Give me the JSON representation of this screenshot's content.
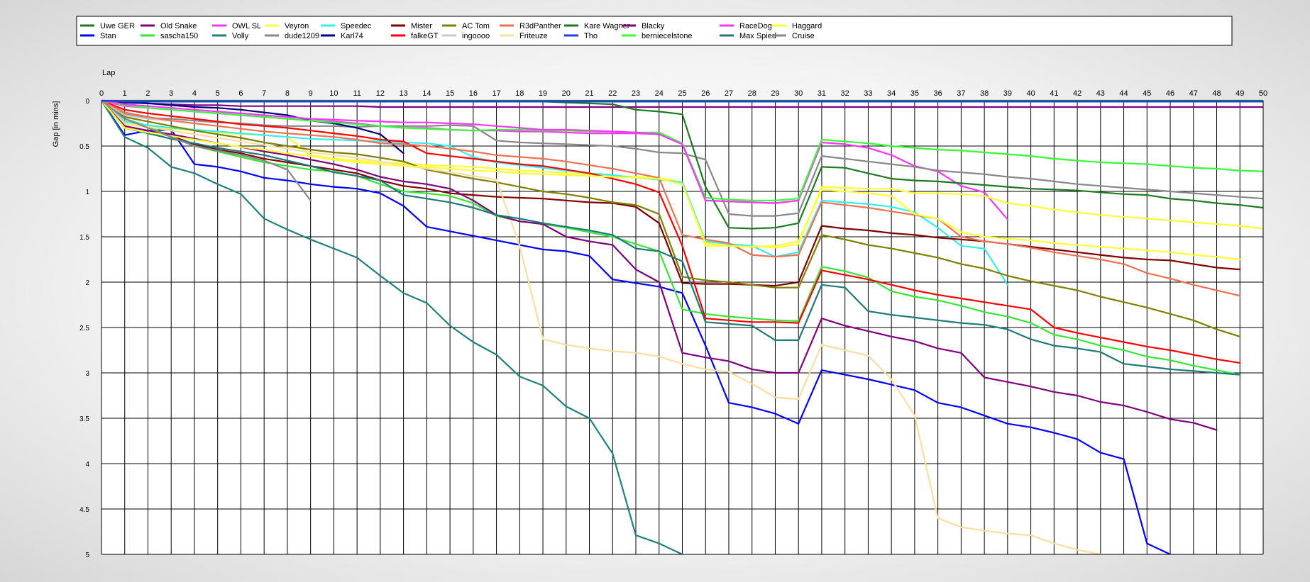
{
  "chart_data": {
    "type": "line",
    "title": "",
    "xlabel": "Lap",
    "ylabel": "Gap [in mins]",
    "x_ticks": [
      0,
      1,
      2,
      3,
      4,
      5,
      6,
      7,
      8,
      9,
      10,
      11,
      12,
      13,
      14,
      15,
      16,
      17,
      18,
      19,
      20,
      21,
      22,
      23,
      24,
      25,
      26,
      27,
      28,
      29,
      30,
      31,
      32,
      33,
      34,
      35,
      36,
      37,
      38,
      39,
      40,
      41,
      42,
      43,
      44,
      45,
      46,
      47,
      48,
      49,
      50
    ],
    "y_ticks": [
      "0",
      "0.5",
      "1",
      "1.5",
      "2",
      "2.5",
      "3",
      "3.5",
      "4",
      "4.5",
      "5"
    ],
    "xlim": [
      0,
      50
    ],
    "ylim": [
      0,
      5
    ],
    "y_inverted": true,
    "grid": true,
    "legend_position": "top",
    "series": [
      {
        "name": "Uwe GER",
        "color": "#1e7a1e",
        "values": [
          0,
          0,
          0,
          0,
          0,
          0,
          0,
          0,
          0,
          0,
          0,
          0,
          0,
          0,
          0,
          0,
          0,
          0,
          0,
          0,
          0,
          0,
          0,
          0,
          0,
          0,
          0,
          0,
          0,
          0,
          0,
          0,
          0,
          0,
          0,
          0,
          0,
          0,
          0,
          0,
          0,
          0,
          0,
          0,
          0,
          0,
          0,
          0,
          0,
          0,
          0
        ]
      },
      {
        "name": "Stan",
        "color": "#0000ff",
        "values": [
          0,
          0.38,
          0.33,
          0.32,
          0.7,
          0.73,
          0.78,
          0.85,
          0.88,
          0.92,
          0.95,
          0.97,
          1.02,
          1.16,
          1.39,
          1.44,
          1.49,
          1.54,
          1.59,
          1.64,
          1.66,
          1.71,
          1.97,
          2.01,
          2.05,
          2.12,
          2.7,
          3.33,
          3.38,
          3.45,
          3.56,
          2.97,
          3.02,
          3.07,
          3.13,
          3.19,
          3.33,
          3.38,
          3.47,
          3.56,
          3.6,
          3.66,
          3.73,
          3.88,
          3.95,
          4.88,
          5.0
        ]
      },
      {
        "name": "Old Snake",
        "color": "#800080",
        "values": [
          0,
          0.02,
          0.03,
          0.04,
          0.05,
          0.05,
          0.06,
          0.06,
          0.06,
          0.06,
          0.06,
          0.06,
          0.07,
          0.07,
          0.07,
          0.07,
          0.07,
          0.07,
          0.07,
          0.07,
          0.07,
          0.07,
          0.07,
          0.07,
          0.07,
          0.07,
          0.07,
          0.07,
          0.07,
          0.07,
          0.07,
          0.07,
          0.07,
          0.07,
          0.07,
          0.07,
          0.07,
          0.07,
          0.07,
          0.07,
          0.07,
          0.07,
          0.07,
          0.07,
          0.07,
          0.07,
          0.07,
          0.07,
          0.07,
          0.07,
          0.07
        ]
      },
      {
        "name": "sascha150",
        "color": "#33e833",
        "values": [
          0,
          0.2,
          0.28,
          0.4,
          0.5,
          0.56,
          0.62,
          0.68,
          0.72,
          0.76,
          0.78,
          0.83,
          0.92,
          1.0,
          1.02,
          1.05,
          1.13,
          1.27,
          1.33,
          1.36,
          1.4,
          1.45,
          1.5,
          1.58,
          1.66,
          2.3,
          2.35,
          2.38,
          2.4,
          2.42,
          2.43,
          1.83,
          1.88,
          1.95,
          2.1,
          2.16,
          2.2,
          2.26,
          2.33,
          2.38,
          2.45,
          2.58,
          2.63,
          2.7,
          2.75,
          2.82,
          2.86,
          2.92,
          2.97,
          3.02
        ]
      },
      {
        "name": "OWL SL",
        "color": "#ff33ff",
        "values": [
          0,
          0.06,
          0.08,
          0.1,
          0.12,
          0.14,
          0.16,
          0.18,
          0.2,
          0.22,
          0.23,
          0.25,
          0.28,
          0.3,
          0.3,
          0.32,
          0.33,
          0.33,
          0.34,
          0.34,
          0.35,
          0.36,
          0.36,
          0.36,
          0.37,
          0.48,
          1.1,
          1.11,
          1.12,
          1.13,
          1.1,
          0.46,
          0.48,
          0.52,
          0.6,
          0.72,
          0.78,
          0.94,
          1.01,
          1.31
        ]
      },
      {
        "name": "Volly",
        "color": "#1e8080",
        "values": [
          0,
          0.4,
          0.52,
          0.73,
          0.8,
          0.92,
          1.03,
          1.3,
          1.42,
          1.53,
          1.63,
          1.73,
          1.93,
          2.12,
          2.23,
          2.48,
          2.66,
          2.8,
          3.04,
          3.14,
          3.37,
          3.5,
          3.89,
          4.79,
          4.88,
          5.0
        ]
      },
      {
        "name": "Veyron",
        "color": "#ffff33",
        "values": [
          0,
          0.26,
          0.29,
          0.31,
          0.33,
          0.35,
          0.37,
          0.38,
          0.4,
          0.6,
          0.64,
          0.66,
          0.68,
          0.69,
          0.71,
          0.72,
          0.73,
          0.75,
          0.77,
          0.78,
          0.8,
          0.81,
          0.83,
          0.84,
          0.85,
          0.9,
          1.6,
          1.6,
          1.6,
          1.62,
          1.58,
          0.95,
          0.96,
          0.97,
          0.97,
          1.02,
          1.02,
          1.03,
          1.05,
          1.13,
          1.16,
          1.2,
          1.23,
          1.26,
          1.28,
          1.3,
          1.32,
          1.34,
          1.36,
          1.38,
          1.41
        ]
      },
      {
        "name": "dude1209",
        "color": "#888888",
        "values": [
          0,
          0.15,
          0.19,
          0.2,
          0.22,
          0.24,
          0.25,
          0.27,
          0.28,
          0.28,
          0.28,
          0.29,
          0.28,
          0.28,
          0.28,
          0.27,
          0.28,
          0.44,
          0.46,
          0.47,
          0.48,
          0.49,
          0.5,
          0.53,
          0.57,
          0.58,
          0.65,
          1.25,
          1.27,
          1.27,
          1.24,
          0.61,
          0.64,
          0.67,
          0.7,
          0.73,
          0.77,
          0.79,
          0.81,
          0.84,
          0.86,
          0.89,
          0.92,
          0.94,
          0.96,
          0.98,
          1.0,
          1.02,
          1.04,
          1.06,
          1.08
        ]
      },
      {
        "name": "Speedec",
        "color": "#33eeee",
        "values": [
          0,
          0.23,
          0.27,
          0.3,
          0.32,
          0.34,
          0.36,
          0.38,
          0.4,
          0.42,
          0.43,
          0.44,
          0.45,
          0.46,
          0.47,
          0.5,
          0.62,
          0.68,
          0.71,
          0.74,
          0.77,
          0.8,
          0.82,
          0.85,
          0.87,
          0.9,
          1.55,
          1.58,
          1.6,
          1.72,
          1.67,
          1.1,
          1.12,
          1.14,
          1.17,
          1.23,
          1.4,
          1.6,
          1.63,
          2.03
        ]
      },
      {
        "name": "Karl74",
        "color": "#000080",
        "values": [
          0,
          0.02,
          0.03,
          0.05,
          0.07,
          0.08,
          0.1,
          0.13,
          0.16,
          0.22,
          0.25,
          0.3,
          0.37,
          0.58
        ]
      },
      {
        "name": "Mister",
        "color": "#800000",
        "values": [
          0,
          0.3,
          0.35,
          0.39,
          0.48,
          0.54,
          0.58,
          0.64,
          0.68,
          0.72,
          0.76,
          0.8,
          0.88,
          0.94,
          0.97,
          1.02,
          1.04,
          1.06,
          1.07,
          1.08,
          1.1,
          1.12,
          1.13,
          1.17,
          1.35,
          2.01,
          2.02,
          2.02,
          2.03,
          2.04,
          2.0,
          1.38,
          1.41,
          1.43,
          1.46,
          1.48,
          1.51,
          1.53,
          1.55,
          1.58,
          1.61,
          1.64,
          1.67,
          1.7,
          1.73,
          1.75,
          1.76,
          1.8,
          1.84,
          1.86
        ]
      },
      {
        "name": "falkeGT",
        "color": "#ff0000",
        "values": [
          0,
          0.1,
          0.14,
          0.17,
          0.2,
          0.23,
          0.26,
          0.28,
          0.3,
          0.33,
          0.36,
          0.39,
          0.43,
          0.45,
          0.58,
          0.61,
          0.64,
          0.67,
          0.7,
          0.72,
          0.76,
          0.8,
          0.86,
          0.92,
          1.01,
          1.6,
          2.4,
          2.42,
          2.44,
          2.44,
          2.45,
          1.87,
          1.92,
          1.97,
          2.03,
          2.09,
          2.14,
          2.18,
          2.22,
          2.26,
          2.3,
          2.5,
          2.56,
          2.61,
          2.66,
          2.71,
          2.75,
          2.8,
          2.85,
          2.89
        ]
      },
      {
        "name": "AC Tom",
        "color": "#808000",
        "values": [
          0,
          0.18,
          0.23,
          0.28,
          0.33,
          0.37,
          0.41,
          0.46,
          0.5,
          0.54,
          0.57,
          0.59,
          0.63,
          0.67,
          0.76,
          0.81,
          0.86,
          0.9,
          0.95,
          1.0,
          1.03,
          1.07,
          1.12,
          1.15,
          1.25,
          1.94,
          1.98,
          2.0,
          2.03,
          2.06,
          2.06,
          1.48,
          1.53,
          1.59,
          1.63,
          1.68,
          1.73,
          1.8,
          1.85,
          1.93,
          1.99,
          2.04,
          2.09,
          2.16,
          2.22,
          2.28,
          2.35,
          2.42,
          2.52,
          2.6
        ]
      },
      {
        "name": "ingoooo",
        "color": "#c8c8c8",
        "values": [
          0,
          0.16,
          0.2,
          0.22
        ]
      },
      {
        "name": "R3dPanther",
        "color": "#f07050",
        "values": [
          0,
          0.13,
          0.18,
          0.22,
          0.25,
          0.28,
          0.31,
          0.34,
          0.36,
          0.38,
          0.4,
          0.43,
          0.47,
          0.48,
          0.5,
          0.53,
          0.56,
          0.6,
          0.62,
          0.64,
          0.67,
          0.71,
          0.75,
          0.8,
          0.85,
          1.48,
          1.53,
          1.57,
          1.7,
          1.72,
          1.7,
          1.12,
          1.15,
          1.18,
          1.22,
          1.26,
          1.3,
          1.5,
          1.55,
          1.58,
          1.62,
          1.67,
          1.71,
          1.75,
          1.8,
          1.9,
          1.96,
          2.03,
          2.09,
          2.15
        ]
      },
      {
        "name": "Friteuze",
        "color": "#ffdda0",
        "values": [
          0,
          0.25,
          0.29,
          0.33,
          0.37,
          0.41,
          0.45,
          0.49,
          0.53,
          0.57,
          0.6,
          0.63,
          0.67,
          0.71,
          0.75,
          0.79,
          0.83,
          0.87,
          1.6,
          2.63,
          2.69,
          2.73,
          2.76,
          2.78,
          2.82,
          2.9,
          2.96,
          2.99,
          3.12,
          3.27,
          3.29,
          2.69,
          2.75,
          2.81,
          3.07,
          3.47,
          4.6,
          4.7,
          4.74,
          4.77,
          4.79,
          4.88,
          4.95,
          5.0
        ]
      },
      {
        "name": "Kare Wagner",
        "color": "#1e7a1e",
        "values": [
          0,
          0.01,
          0.01,
          0.01,
          0.01,
          0.01,
          0.01,
          0.01,
          0.01,
          0.01,
          0.01,
          0.01,
          0.01,
          0.01,
          0.01,
          0.01,
          0.01,
          0.01,
          0.01,
          0.01,
          0.02,
          0.03,
          0.04,
          0.1,
          0.12,
          0.15,
          0.95,
          1.4,
          1.41,
          1.4,
          1.35,
          0.73,
          0.74,
          0.8,
          0.86,
          0.88,
          0.89,
          0.91,
          0.93,
          0.95,
          0.97,
          0.98,
          0.99,
          1.01,
          1.03,
          1.04,
          1.08,
          1.1,
          1.13,
          1.15,
          1.18
        ]
      },
      {
        "name": "Tho",
        "color": "#1e3cff",
        "values": [
          0,
          0.01,
          0.01,
          0.01,
          0.01,
          0.01,
          0.01,
          0.01,
          0.01,
          0.01,
          0.01,
          0.01,
          0.01,
          0.01,
          0.01,
          0.01,
          0.01,
          0.01,
          0.01,
          0.01,
          0.01,
          0.01,
          0.01,
          0.01,
          0.01,
          0.01,
          0.01,
          0.01,
          0.01,
          0.01,
          0.01,
          0.01,
          0.01,
          0.01,
          0.01,
          0.01,
          0.01,
          0.01,
          0.01,
          0.01,
          0.01,
          0.01,
          0.01,
          0.01,
          0.01,
          0.01,
          0.01,
          0.01,
          0.01,
          0.01,
          0.01
        ]
      },
      {
        "name": "Blacky",
        "color": "#800080",
        "values": [
          0,
          0.28,
          0.33,
          0.37,
          0.42,
          0.47,
          0.51,
          0.56,
          0.6,
          0.65,
          0.7,
          0.76,
          0.84,
          0.89,
          0.92,
          0.97,
          1.1,
          1.26,
          1.33,
          1.36,
          1.5,
          1.55,
          1.59,
          1.86,
          2.0,
          2.78,
          2.83,
          2.87,
          2.96,
          3.0,
          3.0,
          2.4,
          2.48,
          2.54,
          2.6,
          2.65,
          2.73,
          2.78,
          3.05,
          3.1,
          3.15,
          3.21,
          3.25,
          3.32,
          3.36,
          3.43,
          3.51,
          3.55,
          3.63
        ]
      },
      {
        "name": "berniecelstone",
        "color": "#33ff33",
        "values": [
          0,
          0.05,
          0.08,
          0.1,
          0.12,
          0.14,
          0.16,
          0.18,
          0.2,
          0.22,
          0.24,
          0.26,
          0.28,
          0.3,
          0.31,
          0.32,
          0.33,
          0.32,
          0.32,
          0.33,
          0.33,
          0.34,
          0.34,
          0.35,
          0.35,
          0.47,
          1.07,
          1.09,
          1.1,
          1.1,
          1.08,
          0.43,
          0.45,
          0.47,
          0.5,
          0.52,
          0.54,
          0.55,
          0.57,
          0.59,
          0.61,
          0.64,
          0.66,
          0.68,
          0.69,
          0.7,
          0.72,
          0.74,
          0.75,
          0.77,
          0.78
        ]
      },
      {
        "name": "RaceDog",
        "color": "#ff33ff",
        "values": [
          0,
          0.04,
          0.06,
          0.08,
          0.1,
          0.12,
          0.14,
          0.16,
          0.18,
          0.2,
          0.21,
          0.22,
          0.23,
          0.24,
          0.24,
          0.25,
          0.26,
          0.28,
          0.3,
          0.32,
          0.32,
          0.33,
          0.34,
          0.35,
          0.37,
          0.48,
          1.1,
          1.11,
          1.12,
          1.13,
          1.1
        ]
      },
      {
        "name": "Max Spied",
        "color": "#1e7a7a",
        "values": [
          0,
          0.3,
          0.36,
          0.42,
          0.47,
          0.52,
          0.56,
          0.6,
          0.66,
          0.72,
          0.79,
          0.83,
          0.88,
          1.04,
          1.08,
          1.12,
          1.18,
          1.26,
          1.3,
          1.35,
          1.39,
          1.43,
          1.48,
          1.63,
          1.66,
          1.77,
          2.44,
          2.46,
          2.48,
          2.64,
          2.64,
          2.03,
          2.06,
          2.32,
          2.36,
          2.39,
          2.42,
          2.45,
          2.47,
          2.52,
          2.63,
          2.7,
          2.73,
          2.77,
          2.9,
          2.93,
          2.96,
          2.98,
          3.0,
          3.02
        ]
      },
      {
        "name": "Haggard",
        "color": "#ffff33",
        "values": [
          0,
          0.3,
          0.35,
          0.39,
          0.43,
          0.47,
          0.51,
          0.54,
          0.58,
          0.61,
          0.65,
          0.68,
          0.7,
          0.72,
          0.73,
          0.75,
          0.77,
          0.78,
          0.8,
          0.81,
          0.82,
          0.83,
          0.84,
          0.85,
          0.86,
          0.92,
          1.57,
          1.6,
          1.61,
          1.6,
          1.55,
          0.98,
          1.0,
          1.02,
          1.05,
          1.25,
          1.3,
          1.45,
          1.5,
          1.52,
          1.54,
          1.57,
          1.59,
          1.61,
          1.63,
          1.65,
          1.67,
          1.7,
          1.72,
          1.75
        ]
      },
      {
        "name": "Cruise",
        "color": "#888888",
        "values": [
          0,
          0.2,
          0.3,
          0.4,
          0.5,
          0.55,
          0.6,
          0.66,
          0.76,
          1.1
        ]
      }
    ]
  }
}
